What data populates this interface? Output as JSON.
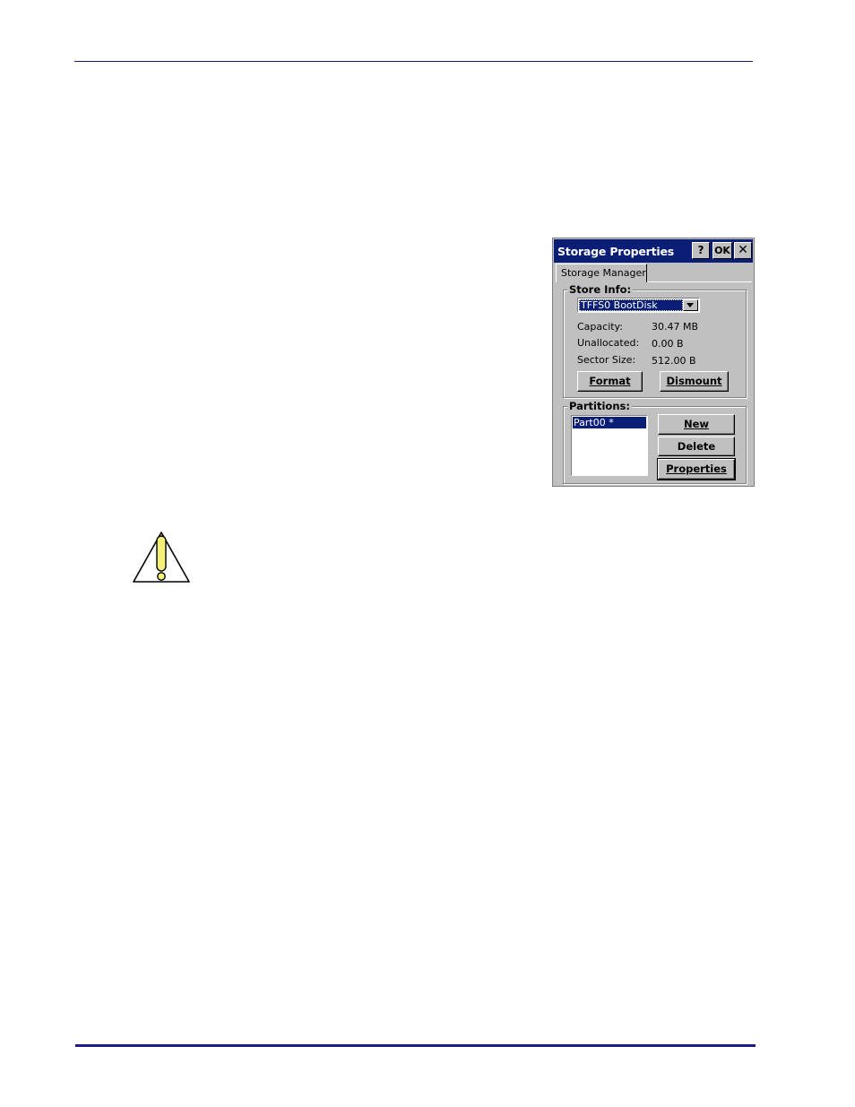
{
  "dialog": {
    "title": "Storage Properties",
    "help_label": "?",
    "ok_label": "OK",
    "close_label": "✕",
    "tab_label": "Storage Manager",
    "store_info": {
      "group_label": "Store Info:",
      "selected_store": "TFFS0 BootDisk",
      "capacity_label": "Capacity:",
      "capacity_value": "30.47 MB",
      "unallocated_label": "Unallocated:",
      "unallocated_value": "0.00 B",
      "sector_size_label": "Sector Size:",
      "sector_size_value": "512.00 B",
      "format_label": "Format",
      "dismount_label": "Dismount"
    },
    "partitions": {
      "group_label": "Partitions:",
      "items": [
        "Part00 *"
      ],
      "new_label": "New",
      "delete_label": "Delete",
      "properties_label": "Properties"
    }
  },
  "icons": {
    "caution": "caution-triangle-icon"
  },
  "colors": {
    "rule": "#1a1a8a",
    "titlebar": "#0a1e78",
    "caution_fill": "#f5f07a"
  }
}
